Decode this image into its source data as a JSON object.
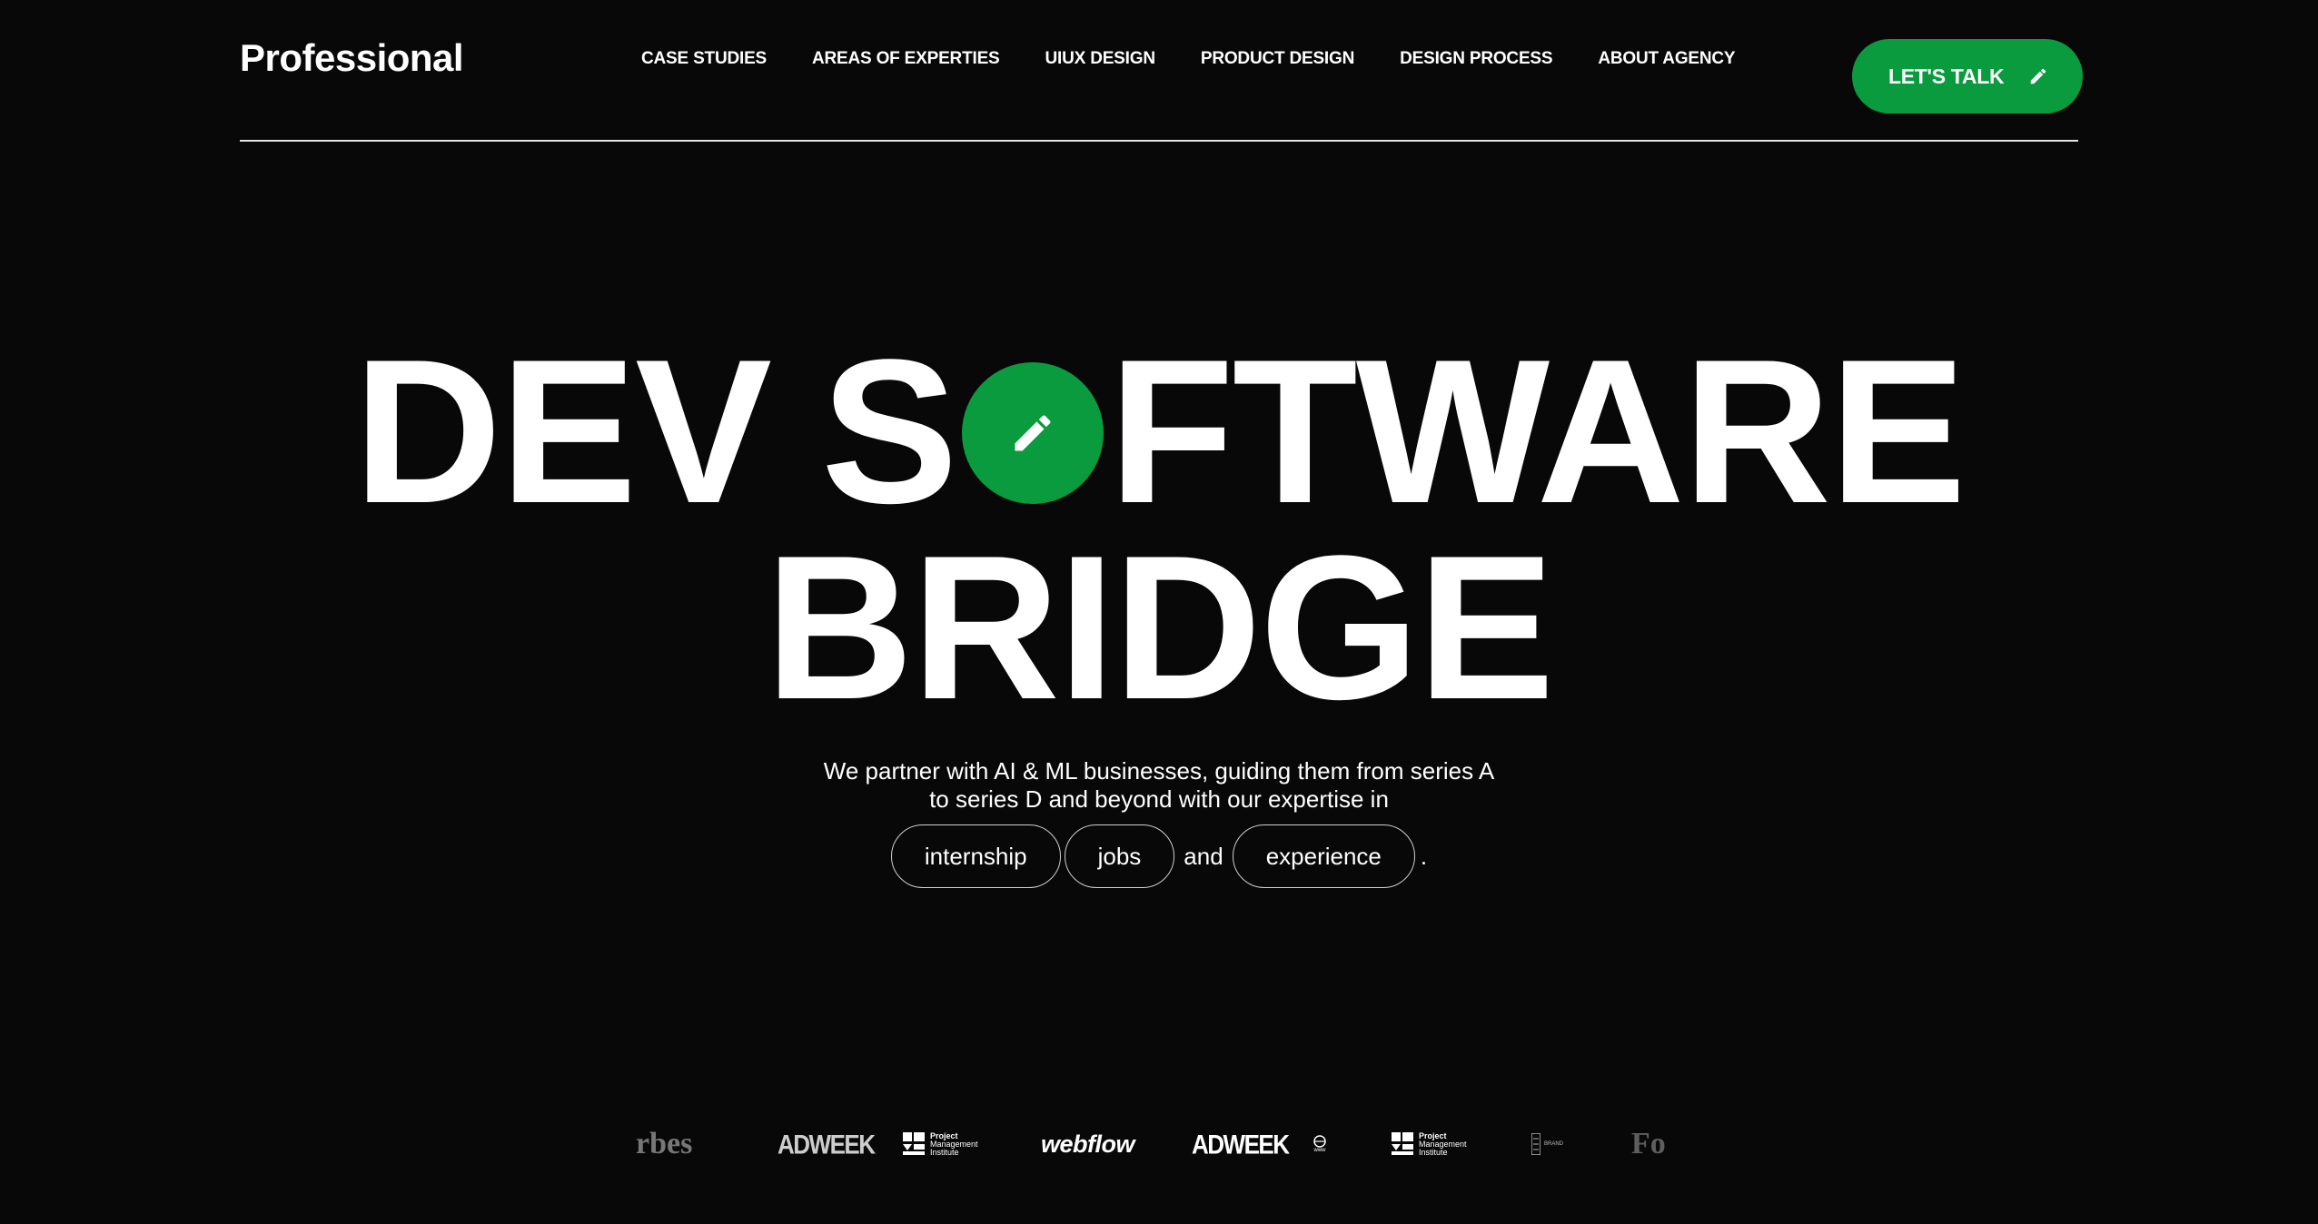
{
  "header": {
    "brand": "Professional",
    "nav": [
      {
        "label": "CASE STUDIES"
      },
      {
        "label": "AREAS OF EXPERTIES"
      },
      {
        "label": "UIUX DESIGN"
      },
      {
        "label": "PRODUCT DESIGN"
      },
      {
        "label": "DESIGN PROCESS"
      },
      {
        "label": "ABOUT AGENCY"
      }
    ],
    "cta_label": "LET'S TALK",
    "cta_icon": "pencil-icon"
  },
  "hero": {
    "line1_word1": "DEV",
    "line1_word2_start": "S",
    "line1_word2_end": "FTWARE",
    "circle_icon": "pencil-icon",
    "line2": "BRIDGE",
    "subtitle_line1": "We partner with AI & ML businesses, guiding them from series A",
    "subtitle_line2": "to series D and beyond with our expertise in",
    "pills": [
      "internship",
      "jobs",
      "experience"
    ],
    "conjunction": "and",
    "end_punct": "."
  },
  "logos": {
    "items": [
      {
        "name": "Forbes",
        "text": "rbes"
      },
      {
        "name": "Adweek",
        "text": "ADWEEK"
      },
      {
        "name": "Project Management Institute",
        "line1": "Project",
        "line2": "Management",
        "line3": "Institute"
      },
      {
        "name": "Webflow",
        "text": "webflow"
      },
      {
        "name": "Adweek",
        "text": "ADWEEK"
      },
      {
        "name": "Small badge",
        "text": "www"
      },
      {
        "name": "Project Management Institute",
        "line1": "Project",
        "line2": "Management",
        "line3": "Institute"
      },
      {
        "name": "Small badge",
        "text": "BRAND"
      },
      {
        "name": "Forbes",
        "text": "Fo"
      }
    ]
  },
  "colors": {
    "background": "#080808",
    "accent_green": "#0a9b3e",
    "text": "#ffffff"
  }
}
